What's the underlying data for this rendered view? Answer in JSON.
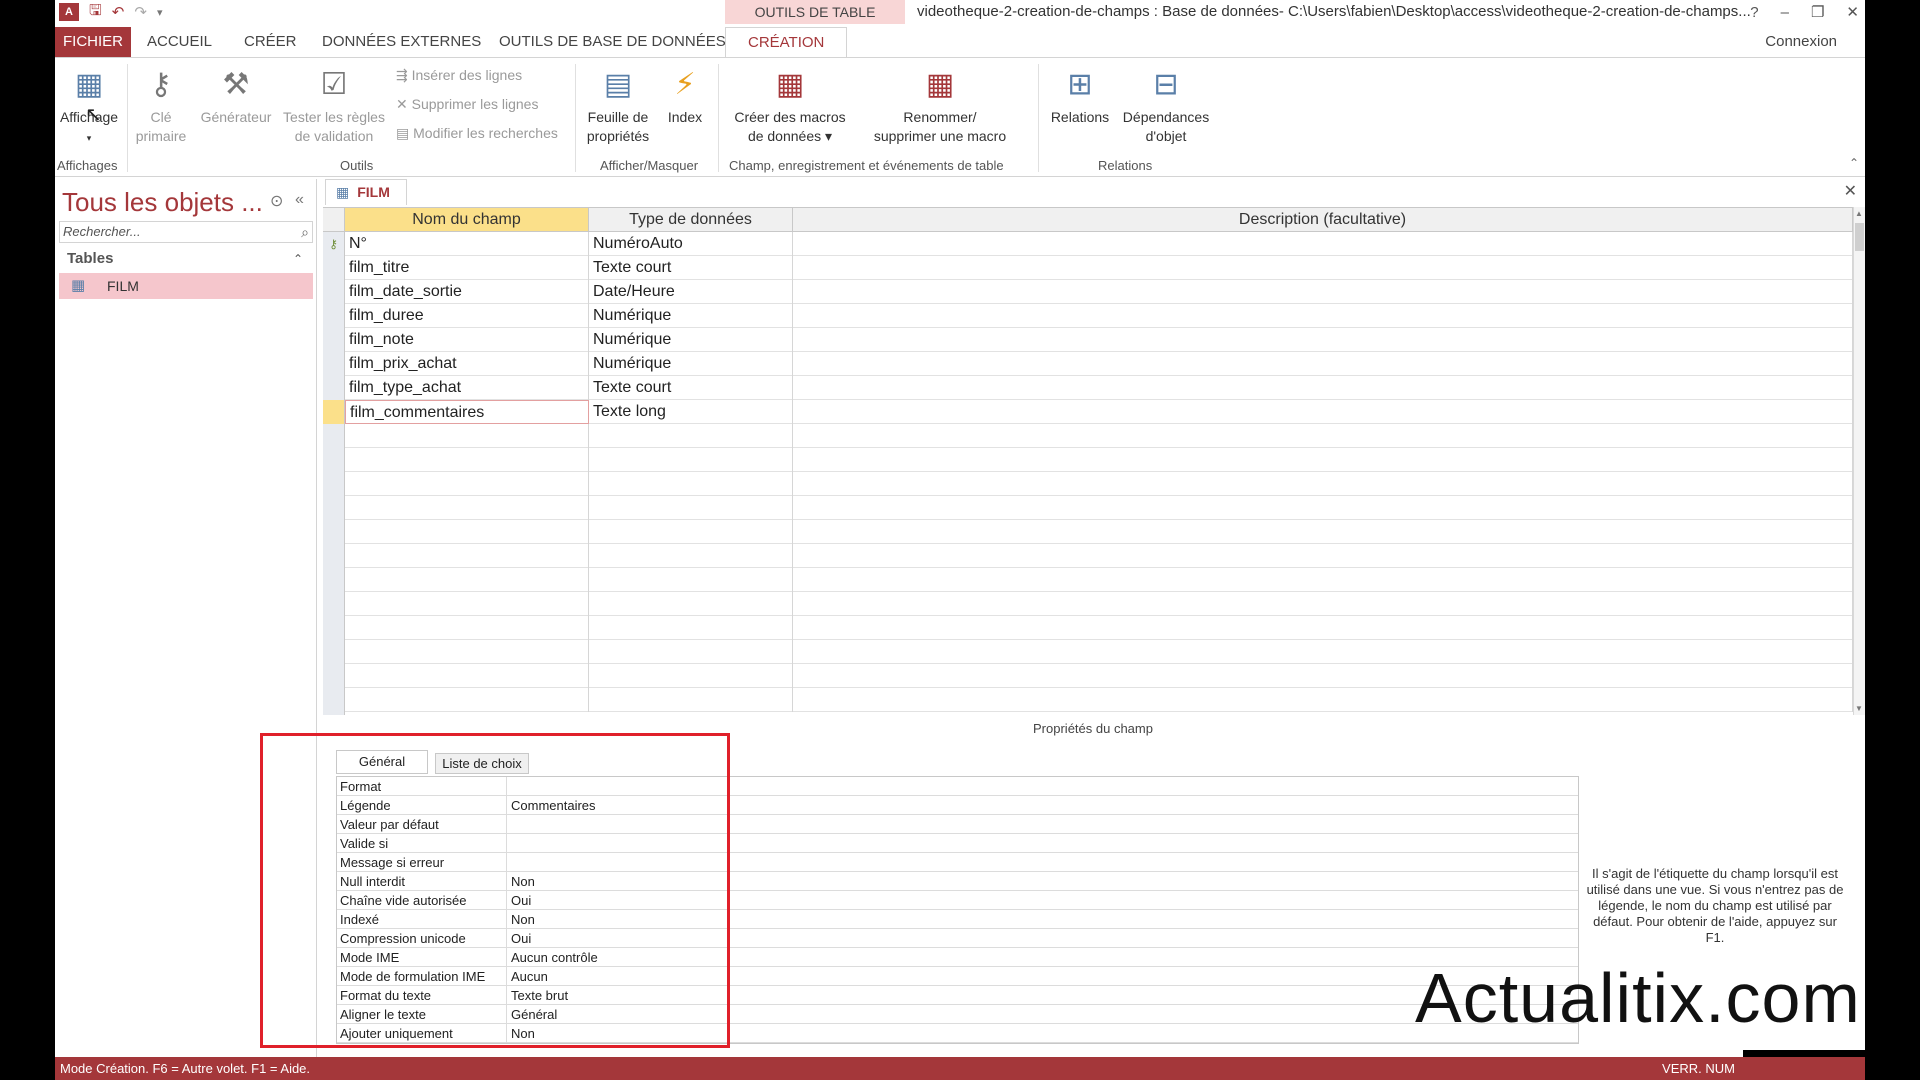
{
  "titlebar": {
    "context_tab": "OUTILS DE TABLE",
    "window_title": "videotheque-2-creation-de-champs : Base de données- C:\\Users\\fabien\\Desktop\\access\\videotheque-2-creation-de-champs...",
    "help": "?",
    "minimize": "–",
    "restore": "❐",
    "close": "✕"
  },
  "tabs": {
    "file": "FICHIER",
    "home": "ACCUEIL",
    "create": "CRÉER",
    "external": "DONNÉES EXTERNES",
    "dbtools": "OUTILS DE BASE DE DONNÉES",
    "design": "CRÉATION",
    "connexion": "Connexion"
  },
  "ribbon": {
    "view": "Affichage",
    "primary_key_1": "Clé",
    "primary_key_2": "primaire",
    "builder": "Générateur",
    "test_rules_1": "Tester les règles",
    "test_rules_2": "de validation",
    "insert_rows": "Insérer des lignes",
    "delete_rows": "Supprimer les lignes",
    "modify_lookups": "Modifier les recherches",
    "property_sheet_1": "Feuille de",
    "property_sheet_2": "propriétés",
    "indexes": "Index",
    "create_macros_1": "Créer des macros",
    "create_macros_2": "de données ▾",
    "rename_macro_1": "Renommer/",
    "rename_macro_2": "supprimer une macro",
    "relations": "Relations",
    "dependencies_1": "Dépendances",
    "dependencies_2": "d'objet",
    "group_views": "Affichages",
    "group_tools": "Outils",
    "group_show_hide": "Afficher/Masquer",
    "group_events": "Champ, enregistrement et événements de table",
    "group_relations": "Relations"
  },
  "nav": {
    "title": "Tous les objets ...",
    "search_placeholder": "Rechercher...",
    "group": "Tables",
    "item": "FILM"
  },
  "document": {
    "tab": "FILM",
    "headers": [
      "Nom du champ",
      "Type de données",
      "Description (facultative)"
    ],
    "rows": [
      {
        "name": "N°",
        "type": "NuméroAuto"
      },
      {
        "name": "film_titre",
        "type": "Texte court"
      },
      {
        "name": "film_date_sortie",
        "type": "Date/Heure"
      },
      {
        "name": "film_duree",
        "type": "Numérique"
      },
      {
        "name": "film_note",
        "type": "Numérique"
      },
      {
        "name": "film_prix_achat",
        "type": "Numérique"
      },
      {
        "name": "film_type_achat",
        "type": "Texte court"
      },
      {
        "name": "film_commentaires",
        "type": "Texte long"
      }
    ]
  },
  "properties": {
    "title": "Propriétés du champ",
    "tab_general": "Général",
    "tab_lookup": "Liste de choix",
    "rows": [
      {
        "name": "Format",
        "value": ""
      },
      {
        "name": "Légende",
        "value": "Commentaires"
      },
      {
        "name": "Valeur par défaut",
        "value": ""
      },
      {
        "name": "Valide si",
        "value": ""
      },
      {
        "name": "Message si erreur",
        "value": ""
      },
      {
        "name": "Null interdit",
        "value": "Non"
      },
      {
        "name": "Chaîne vide autorisée",
        "value": "Oui"
      },
      {
        "name": "Indexé",
        "value": "Non"
      },
      {
        "name": "Compression unicode",
        "value": "Oui"
      },
      {
        "name": "Mode IME",
        "value": "Aucun contrôle"
      },
      {
        "name": "Mode de formulation IME",
        "value": "Aucun"
      },
      {
        "name": "Format du texte",
        "value": "Texte brut"
      },
      {
        "name": "Aligner le texte",
        "value": "Général"
      },
      {
        "name": "Ajouter uniquement",
        "value": "Non"
      }
    ],
    "help": "Il s'agit de l'étiquette du champ lorsqu'il est utilisé dans une vue. Si vous n'entrez pas de légende, le nom du champ est utilisé par défaut. Pour obtenir de l'aide, appuyez sur F1."
  },
  "watermark": "Actualitix.com",
  "status": {
    "left": "Mode Création. F6 = Autre volet. F1 = Aide.",
    "right": "VERR. NUM"
  },
  "colors": {
    "accent": "#a4373a",
    "selection": "#fbe08a",
    "nav_selected": "#f5c6cc",
    "highlight_box": "#e0202a"
  }
}
